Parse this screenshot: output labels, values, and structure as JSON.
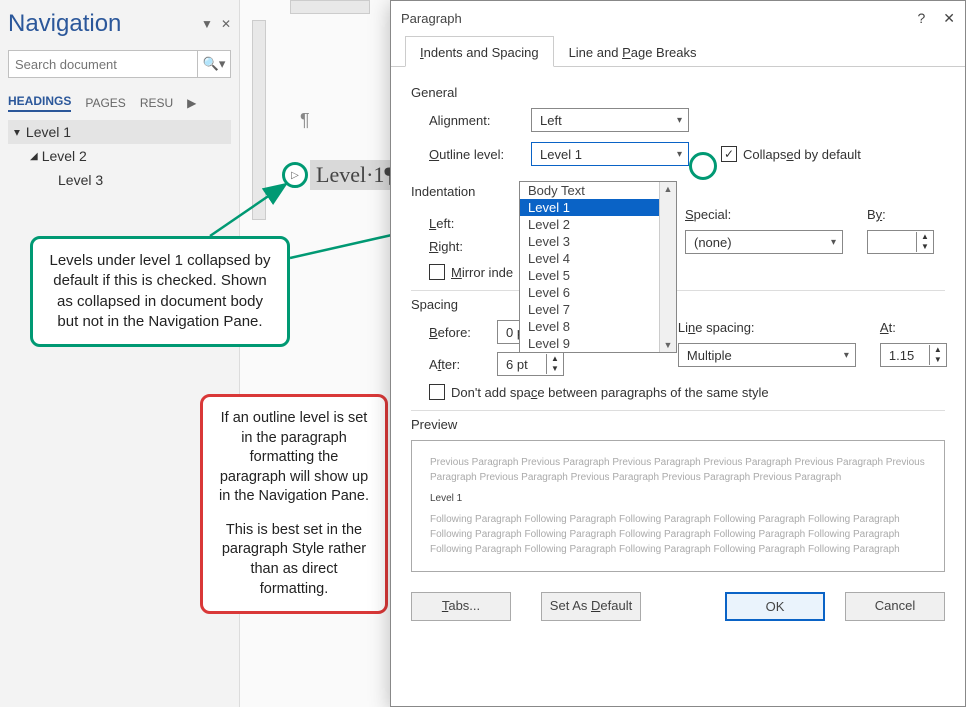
{
  "nav": {
    "title": "Navigation",
    "search_placeholder": "Search document",
    "tabs": {
      "headings": "HEADINGS",
      "pages": "PAGES",
      "results": "RESU"
    },
    "items": [
      {
        "label": "Level 1",
        "level": 1,
        "selected": true,
        "expand": "▲"
      },
      {
        "label": "Level 2",
        "level": 2,
        "selected": false,
        "expand": "▲"
      },
      {
        "label": "Level 3",
        "level": 3,
        "selected": false,
        "expand": ""
      }
    ]
  },
  "document": {
    "heading_text": "Level·1¶",
    "paragraph_mark": "¶",
    "collapse_indicator": "▷"
  },
  "callouts": {
    "teal": "Levels under level 1 collapsed by default if this is checked. Shown as collapsed in document body but not in the Navigation Pane.",
    "red_p1": "If an outline level is set in the paragraph formatting the paragraph will show up in the Navigation Pane.",
    "red_p2": "This is best set in the paragraph Style rather than as direct formatting."
  },
  "dialog": {
    "title": "Paragraph",
    "help": "?",
    "close": "✕",
    "tabs": {
      "indents": "Indents and Spacing",
      "breaks": "Line and Page Breaks"
    },
    "general_label": "General",
    "alignment_label": "Alignment:",
    "alignment_value": "Left",
    "outline_label": "Outline level:",
    "outline_value": "Level 1",
    "collapsed_label": "Collapsed by default",
    "collapsed_checked": "✓",
    "outline_options": [
      "Body Text",
      "Level 1",
      "Level 2",
      "Level 3",
      "Level 4",
      "Level 5",
      "Level 6",
      "Level 7",
      "Level 8",
      "Level 9"
    ],
    "indentation_label": "Indentation",
    "left_label": "Left:",
    "right_label": "Right:",
    "mirror_label": "Mirror inde",
    "special_label": "Special:",
    "special_value": "(none)",
    "by_label": "By:",
    "spacing_label": "Spacing",
    "before_label": "Before:",
    "before_value": "0 pt",
    "after_label": "After:",
    "after_value": "6 pt",
    "line_spacing_label": "Line spacing:",
    "line_spacing_value": "Multiple",
    "at_label": "At:",
    "at_value": "1.15",
    "dont_add_label": "Don't add space between paragraphs of the same style",
    "preview_label": "Preview",
    "preview_prev": "Previous Paragraph Previous Paragraph Previous Paragraph Previous Paragraph Previous Paragraph Previous Paragraph Previous Paragraph Previous Paragraph Previous Paragraph Previous Paragraph",
    "preview_current": "Level 1",
    "preview_next": "Following Paragraph Following Paragraph Following Paragraph Following Paragraph Following Paragraph Following Paragraph Following Paragraph Following Paragraph Following Paragraph Following Paragraph Following Paragraph Following Paragraph Following Paragraph Following Paragraph Following Paragraph",
    "buttons": {
      "tabs": "Tabs...",
      "default": "Set As Default",
      "ok": "OK",
      "cancel": "Cancel"
    }
  }
}
